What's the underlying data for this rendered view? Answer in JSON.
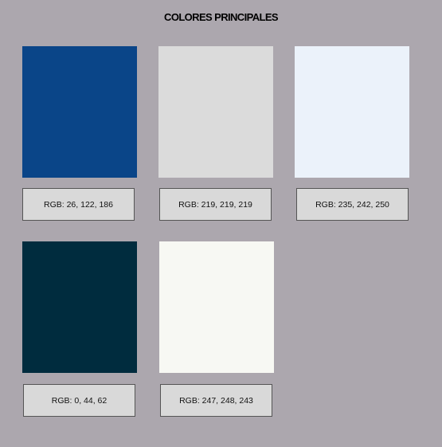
{
  "title": "COLORES PRINCIPALES",
  "colors": [
    {
      "hex": "#0a4588",
      "label": "RGB: 26, 122, 186"
    },
    {
      "hex": "#dbdbdb",
      "label": "RGB: 219, 219, 219"
    },
    {
      "hex": "#ebf2fa",
      "label": "RGB: 235, 242, 250"
    },
    {
      "hex": "#002c3e",
      "label": "RGB: 0, 44, 62"
    },
    {
      "hex": "#f7f8f3",
      "label": "RGB: 247, 248, 243"
    }
  ]
}
